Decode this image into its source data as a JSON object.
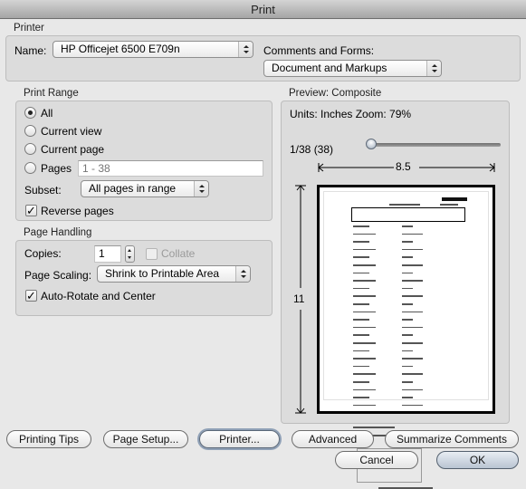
{
  "window": {
    "title": "Print"
  },
  "printer": {
    "section_label": "Printer",
    "name_label": "Name:",
    "name_value": "HP Officejet 6500 E709n",
    "comments_label": "Comments and Forms:",
    "comments_value": "Document and Markups"
  },
  "print_range": {
    "section_label": "Print Range",
    "options": [
      {
        "label": "All",
        "selected": true
      },
      {
        "label": "Current view",
        "selected": false
      },
      {
        "label": "Current page",
        "selected": false
      },
      {
        "label": "Pages",
        "selected": false
      }
    ],
    "pages_placeholder": "1 - 38",
    "subset_label": "Subset:",
    "subset_value": "All pages in range",
    "reverse_pages_label": "Reverse pages",
    "reverse_pages_checked": true
  },
  "page_handling": {
    "section_label": "Page Handling",
    "copies_label": "Copies:",
    "copies_value": "1",
    "collate_label": "Collate",
    "collate_checked": false,
    "collate_enabled": false,
    "scaling_label": "Page Scaling:",
    "scaling_value": "Shrink to Printable Area",
    "auto_rotate_label": "Auto-Rotate and Center",
    "auto_rotate_checked": true
  },
  "preview": {
    "section_label": "Preview: Composite",
    "units_zoom_text": "Units: Inches Zoom:  79%",
    "page_indicator": "1/38 (38)",
    "page_slider_value": 1,
    "page_slider_max": 38,
    "width_label": "8.5",
    "height_label": "11"
  },
  "buttons": {
    "printing_tips": "Printing Tips",
    "page_setup": "Page Setup...",
    "printer": "Printer...",
    "advanced": "Advanced",
    "summarize_comments": "Summarize Comments",
    "cancel": "Cancel",
    "ok": "OK"
  }
}
